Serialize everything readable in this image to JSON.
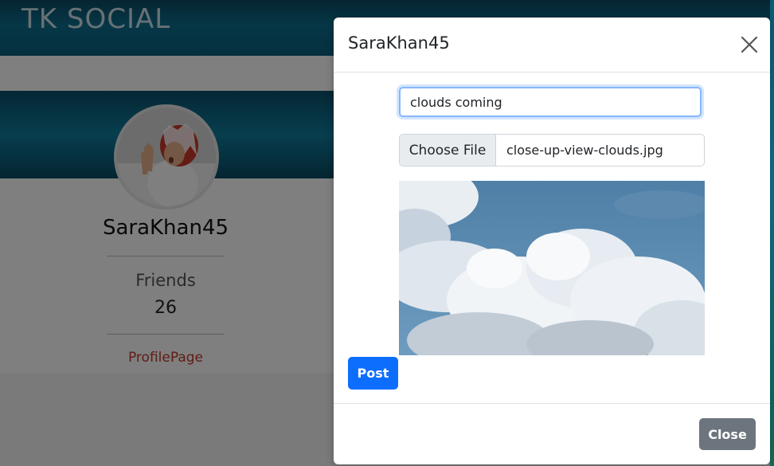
{
  "app": {
    "brand": "TK SOCIAL"
  },
  "profile": {
    "username": "SaraKhan45",
    "friends_label": "Friends",
    "friends_count": "26",
    "profile_link": "ProfilePage",
    "avatar_icon": "user-avatar-photo"
  },
  "modal": {
    "title": "SaraKhan45",
    "close_icon": "close-icon",
    "text_input": {
      "value": "clouds coming"
    },
    "file_input": {
      "button_label": "Choose File",
      "file_name": "close-up-view-clouds.jpg"
    },
    "preview_image": "clouds-photo",
    "post_label": "Post",
    "close_label": "Close"
  },
  "colors": {
    "primary": "#0d6efd",
    "secondary": "#6c757d",
    "brand_bar": "#0b5f7c",
    "link": "#c0392b"
  }
}
